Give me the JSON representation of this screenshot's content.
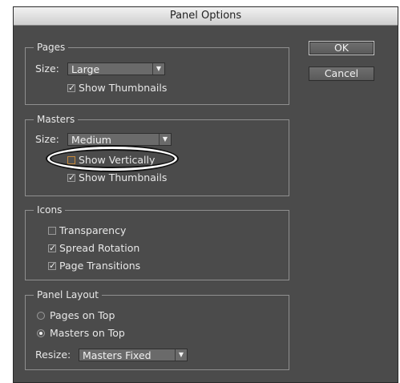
{
  "window": {
    "title": "Panel Options"
  },
  "buttons": {
    "ok": "OK",
    "cancel": "Cancel"
  },
  "pages": {
    "title": "Pages",
    "size_label": "Size:",
    "size_value": "Large",
    "show_thumbnails": {
      "label": "Show Thumbnails",
      "checked": true
    }
  },
  "masters": {
    "title": "Masters",
    "size_label": "Size:",
    "size_value": "Medium",
    "show_vertically": {
      "label": "Show Vertically",
      "checked": false
    },
    "show_thumbnails": {
      "label": "Show Thumbnails",
      "checked": true
    }
  },
  "icons": {
    "title": "Icons",
    "transparency": {
      "label": "Transparency",
      "checked": false
    },
    "spread_rotation": {
      "label": "Spread Rotation",
      "checked": true
    },
    "page_transitions": {
      "label": "Page Transitions",
      "checked": true
    }
  },
  "panel_layout": {
    "title": "Panel Layout",
    "pages_on_top": {
      "label": "Pages on Top",
      "selected": false
    },
    "masters_on_top": {
      "label": "Masters on Top",
      "selected": true
    },
    "resize_label": "Resize:",
    "resize_value": "Masters Fixed"
  },
  "glyphs": {
    "check": "✓",
    "arrow": "▼"
  }
}
